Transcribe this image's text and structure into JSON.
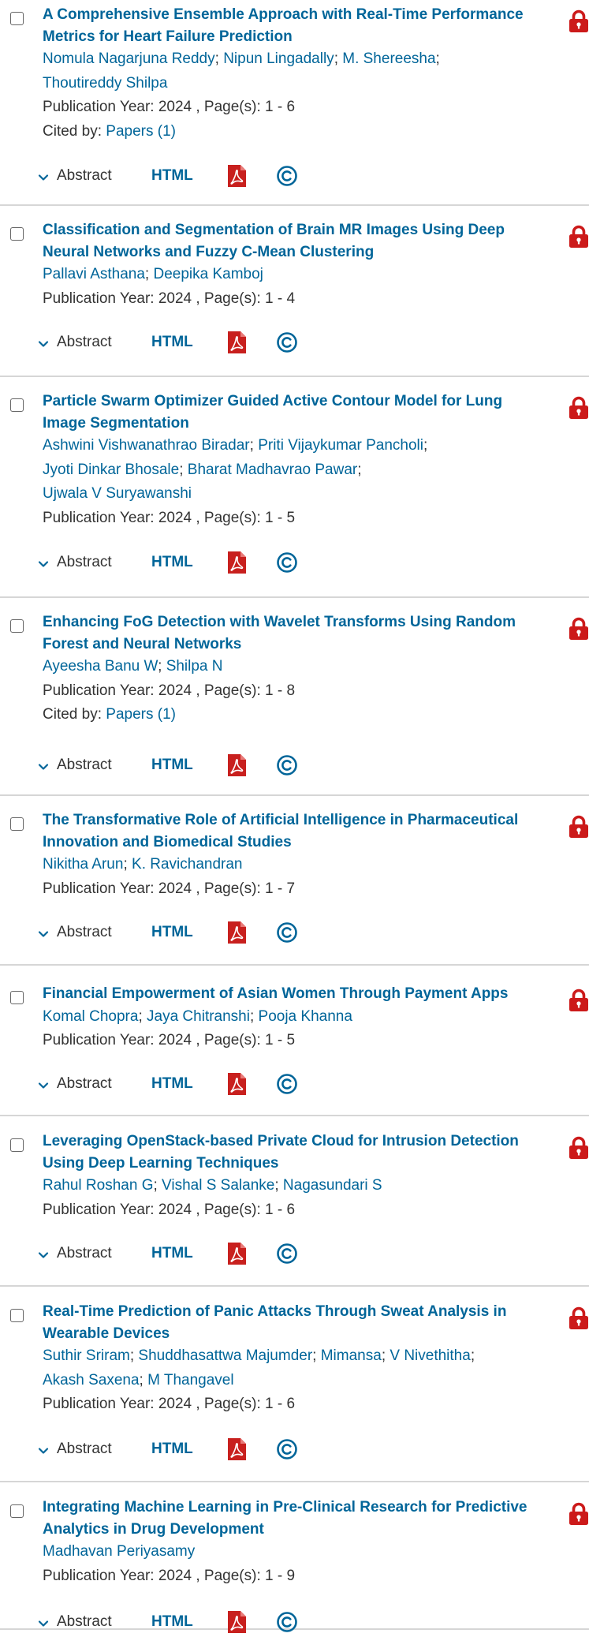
{
  "actions": {
    "abstract_label": "Abstract",
    "html_label": "HTML"
  },
  "icons": {
    "expand": "chevron-down-icon",
    "pdf": "pdf-icon",
    "rights": "copyright-icon",
    "access": "lock-icon"
  },
  "colors": {
    "link": "#006599",
    "lock": "#cc1a1a",
    "pdf": "#c8201e",
    "divider": "#d6d6d6"
  },
  "results": [
    {
      "title": "A Comprehensive Ensemble Approach with Real-Time Performance Metrics for Heart Failure Prediction",
      "authors": [
        "Nomula Nagarjuna Reddy",
        "Nipun Lingadally",
        "M. Shereesha",
        "Thoutireddy Shilpa"
      ],
      "pub": "Publication Year: 2024 , Page(s): 1  -  6",
      "cited_label": "Cited by: ",
      "cited_link": "Papers (1)"
    },
    {
      "title": "Classification and Segmentation of Brain MR Images Using Deep Neural Networks and Fuzzy C-Mean Clustering",
      "authors": [
        "Pallavi Asthana",
        "Deepika Kamboj"
      ],
      "pub": "Publication Year: 2024 , Page(s): 1  -  4"
    },
    {
      "title": "Particle Swarm Optimizer Guided Active Contour Model for Lung Image Segmentation",
      "authors": [
        "Ashwini Vishwanathrao Biradar",
        "Priti Vijaykumar Pancholi",
        "Jyoti Dinkar Bhosale",
        "Bharat Madhavrao Pawar",
        "Ujwala V Suryawanshi"
      ],
      "pub": "Publication Year: 2024 , Page(s): 1  -  5"
    },
    {
      "title": "Enhancing FoG Detection with Wavelet Transforms Using Random Forest and Neural Networks",
      "authors": [
        "Ayeesha Banu W",
        "Shilpa N"
      ],
      "pub": "Publication Year: 2024 , Page(s): 1  -  8",
      "cited_label": "Cited by: ",
      "cited_link": "Papers (1)"
    },
    {
      "title": "The Transformative Role of Artificial Intelligence in Pharmaceutical Innovation and Biomedical Studies",
      "authors": [
        "Nikitha Arun",
        "K. Ravichandran"
      ],
      "pub": "Publication Year: 2024 , Page(s): 1  -  7"
    },
    {
      "title": "Financial Empowerment of Asian Women Through Payment Apps",
      "authors": [
        "Komal Chopra",
        "Jaya Chitranshi",
        "Pooja Khanna"
      ],
      "pub": "Publication Year: 2024 , Page(s): 1  -  5"
    },
    {
      "title": "Leveraging OpenStack-based Private Cloud for Intrusion Detection Using Deep Learning Techniques",
      "authors": [
        "Rahul Roshan G",
        "Vishal S Salanke",
        "Nagasundari S"
      ],
      "pub": "Publication Year: 2024 , Page(s): 1  -  6"
    },
    {
      "title": "Real-Time Prediction of Panic Attacks Through Sweat Analysis in Wearable Devices",
      "authors": [
        "Suthir Sriram",
        "Shuddhasattwa Majumder",
        "Mimansa",
        "V Nivethitha",
        "Akash Saxena",
        "M Thangavel"
      ],
      "pub": "Publication Year: 2024 , Page(s): 1  -  6"
    },
    {
      "title": "Integrating Machine Learning in Pre-Clinical Research for Predictive Analytics in Drug Development",
      "authors": [
        "Madhavan Periyasamy"
      ],
      "pub": "Publication Year: 2024 , Page(s): 1  -  9"
    }
  ]
}
